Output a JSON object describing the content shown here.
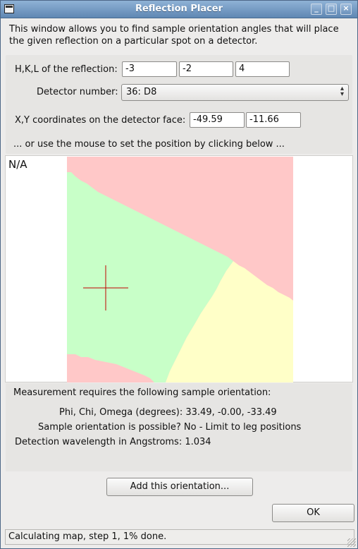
{
  "window": {
    "title": "Reflection Placer"
  },
  "intro_text": "This window allows you to find sample orientation angles that will place the given reflection on a particular spot on a detector.",
  "hkl": {
    "label": "H,K,L of the reflection:",
    "h": "-3",
    "k": "-2",
    "l": "4"
  },
  "detector": {
    "label": "Detector number:",
    "selected": "36: D8"
  },
  "xy": {
    "label": "X,Y coordinates on the detector face:",
    "x": "-49.59",
    "y": "-11.66"
  },
  "mouse_hint": "... or use the mouse to set the position by clicking below ...",
  "map": {
    "corner_text": "N/A",
    "colors": {
      "pink": "#ffc8c8",
      "green": "#c8ffc8",
      "yellow": "#ffffc8",
      "crosshair": "#c00000"
    }
  },
  "results": {
    "heading": "Measurement requires the following sample orientation:",
    "angles": "Phi, Chi, Omega (degrees): 33.49, -0.00, -33.49",
    "possible": "Sample orientation is possible? No - Limit to leg positions",
    "wavelength": "Detection wavelength in Angstroms: 1.034"
  },
  "buttons": {
    "add": "Add this orientation...",
    "ok": "OK"
  },
  "status": "Calculating map, step 1, 1% done."
}
